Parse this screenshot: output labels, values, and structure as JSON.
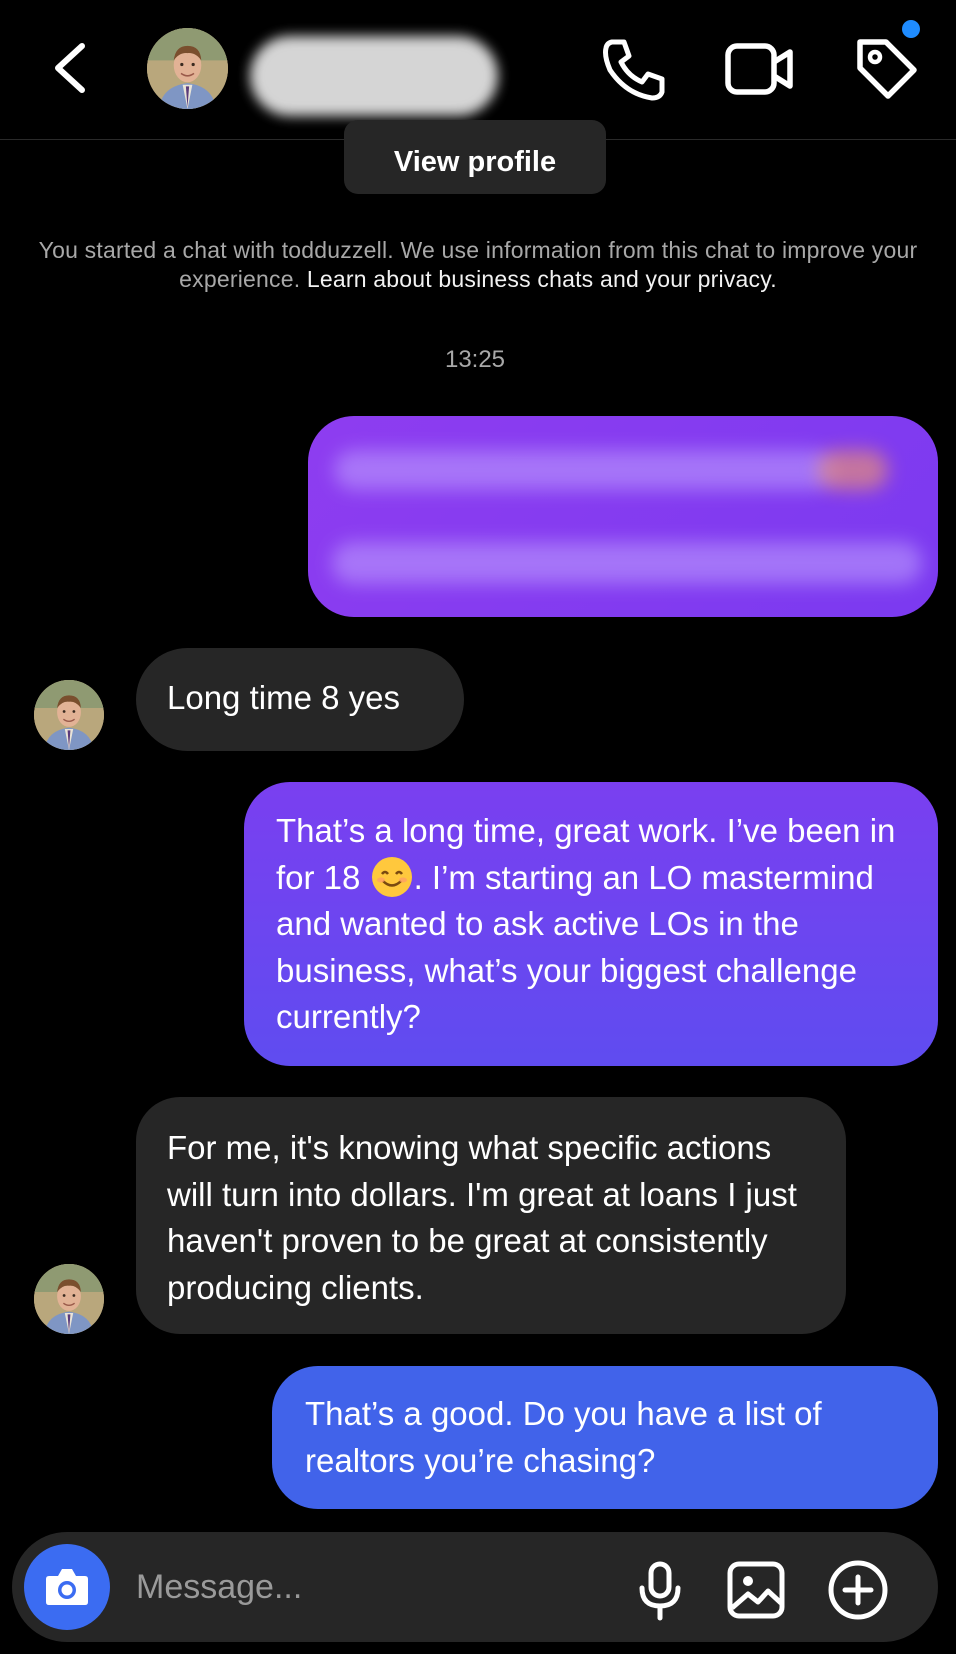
{
  "header": {
    "back_icon": "chevron-left-icon",
    "contact_name_redacted": true,
    "call_icon": "phone-icon",
    "video_icon": "video-camera-icon",
    "tag_icon": "tag-icon",
    "notification_dot_color": "#1f8cff"
  },
  "view_profile_label": "View profile",
  "notice": {
    "text": "You started a chat with todduzzell. We use information from this chat to improve your experience.",
    "link": "Learn about business chats and your privacy."
  },
  "timestamp": "13:25",
  "messages": [
    {
      "sender": "me",
      "redacted": true
    },
    {
      "sender": "contact",
      "text": "Long time 8 yes"
    },
    {
      "sender": "me",
      "text_before_emoji": "That’s a long time, great work.  I’ve been in for 18 ",
      "emoji": "smiling-face",
      "text_after_emoji": ". I’m starting an LO mastermind and wanted to ask active LOs in the business, what’s your biggest challenge currently?"
    },
    {
      "sender": "contact",
      "text": "For me, it's knowing what specific actions will turn into dollars.  I'm great at loans I just haven't proven to be great at consistently producing clients."
    },
    {
      "sender": "me",
      "text": "That’s a good.  Do you have a list of realtors you’re chasing?"
    }
  ],
  "composer": {
    "placeholder": "Message...",
    "camera_icon": "camera-icon",
    "mic_icon": "microphone-icon",
    "gallery_icon": "image-icon",
    "plus_icon": "plus-circle-icon"
  },
  "colors": {
    "background": "#000000",
    "incoming_bubble": "#262626",
    "outgoing_purple": "#6a45f0",
    "outgoing_blue": "#4163ea",
    "camera_button": "#3b6cf2"
  }
}
